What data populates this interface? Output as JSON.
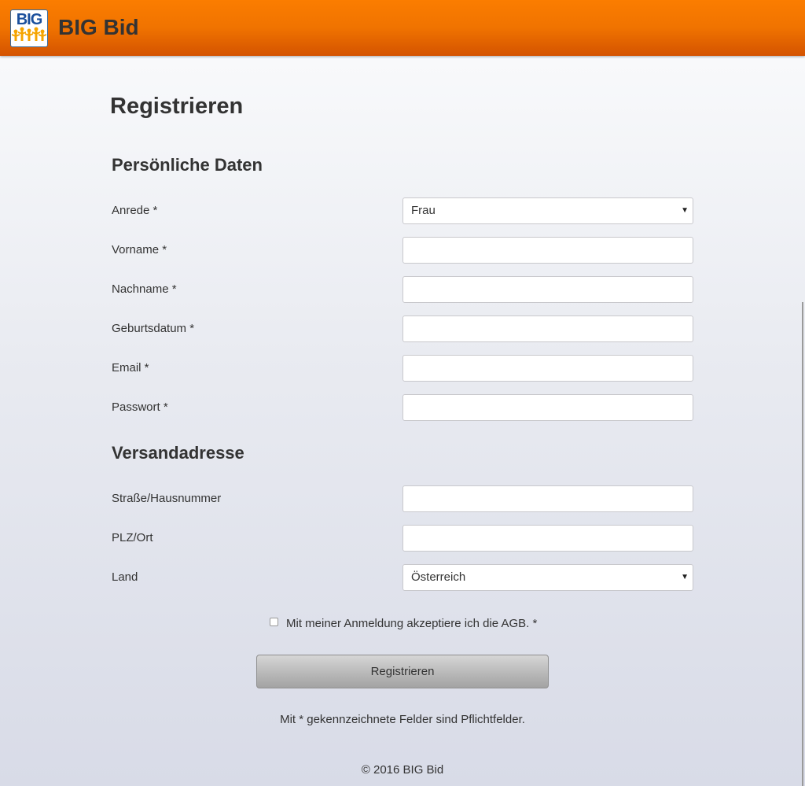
{
  "header": {
    "logo_text": "BIG",
    "brand": "BIG Bid",
    "colors": {
      "bar_top": "#fb7d00",
      "bar_bottom": "#d45300",
      "logo_blue": "#1a4f9c",
      "logo_figures": "#f5a400"
    }
  },
  "page": {
    "title": "Registrieren"
  },
  "personal": {
    "heading": "Persönliche Daten",
    "anrede_label": "Anrede *",
    "anrede_value": "Frau",
    "vorname_label": "Vorname *",
    "vorname_value": "",
    "nachname_label": "Nachname *",
    "nachname_value": "",
    "geburtsdatum_label": "Geburtsdatum *",
    "geburtsdatum_value": "",
    "email_label": "Email *",
    "email_value": "",
    "passwort_label": "Passwort *",
    "passwort_value": ""
  },
  "shipping": {
    "heading": "Versandadresse",
    "strasse_label": "Straße/Hausnummer",
    "strasse_value": "",
    "plz_label": "PLZ/Ort",
    "plz_value": "",
    "land_label": "Land",
    "land_value": "Österreich"
  },
  "agb": {
    "label": "Mit meiner Anmeldung akzeptiere ich die AGB. *",
    "checked": false
  },
  "submit_label": "Registrieren",
  "required_note": "Mit * gekennzeichnete Felder sind Pflichtfelder.",
  "footer": "© 2016 BIG Bid",
  "icons": {
    "select_arrow": "chevron-down-icon",
    "logo": "big-bid-logo-icon"
  }
}
